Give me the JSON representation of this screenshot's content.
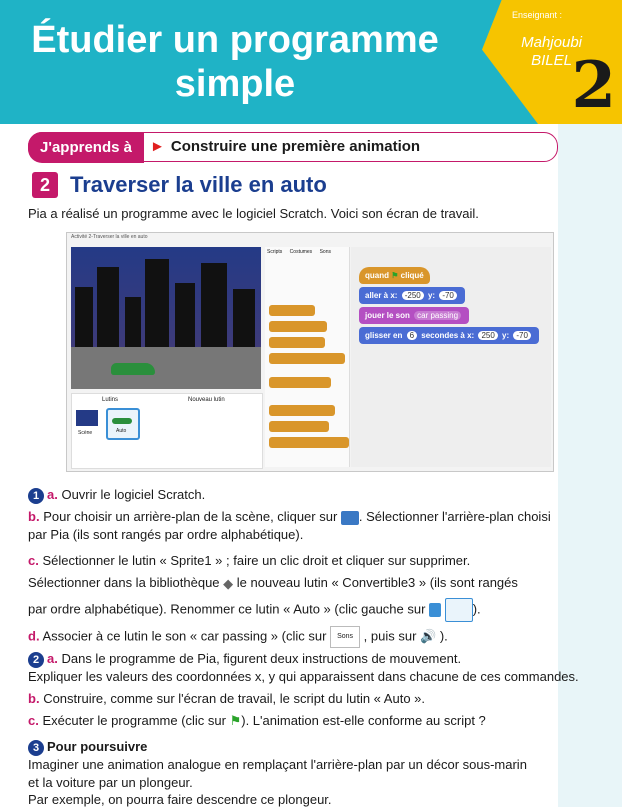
{
  "header": {
    "title_line1": "Étudier un programme",
    "title_line2": "simple",
    "teacher_label": "Enseignant :",
    "teacher_name1": "Mahjoubi",
    "teacher_name2": "BILEL",
    "grade": "2"
  },
  "learn": {
    "tag": "J'apprends à",
    "text": "Construire une première animation"
  },
  "section": {
    "number": "2",
    "title": "Traverser la ville en auto",
    "intro": "Pia a réalisé un programme avec le logiciel Scratch. Voici son écran de travail."
  },
  "scratch": {
    "project_title": "Activité 2-Traverser la ville en auto",
    "tabs": [
      "Scripts",
      "Costumes",
      "Sons"
    ],
    "script_blocks": {
      "when_flag": "quand",
      "when_flag_suffix": "cliqué",
      "goto": "aller à x:",
      "goto_x": "-250",
      "goto_y_label": "y:",
      "goto_y": "-70",
      "play_sound": "jouer le son",
      "sound_name": "car passing",
      "glide": "glisser en",
      "glide_secs": "6",
      "glide_secs_label": "secondes à x:",
      "glide_x": "250",
      "glide_y_label": "y:",
      "glide_y": "-70"
    },
    "sprites_label": "Lutins",
    "new_sprite_label": "Nouveau lutin",
    "stage_label": "Scène",
    "sprite_name": "Auto"
  },
  "q1": {
    "num": "1",
    "a_label": "a.",
    "a_text": "Ouvrir le logiciel Scratch.",
    "b_label": "b.",
    "b_text1": "Pour choisir un arrière-plan de la scène, cliquer sur",
    "b_text2": ". Sélectionner l'arrière-plan choisi",
    "b_text3": "par Pia (ils sont rangés par ordre alphabétique).",
    "c_label": "c.",
    "c_text1": "Sélectionner le lutin « Sprite1 » ; faire un clic droit et cliquer sur supprimer.",
    "c_text2a": "Sélectionner dans la bibliothèque",
    "c_text2b": "le nouveau lutin « Convertible3 » (ils sont rangés",
    "c_text3a": "par ordre alphabétique). Renommer ce lutin « Auto » (clic gauche sur",
    "c_text3b": ").",
    "d_label": "d.",
    "d_text1": "Associer à ce lutin le son « car passing » (clic sur",
    "d_sons": "Sons",
    "d_text2": ", puis sur",
    "d_text3": ")."
  },
  "q2": {
    "num": "2",
    "a_label": "a.",
    "a_text1": "Dans le programme de Pia, figurent deux instructions de mouvement.",
    "a_text2": "Expliquer les valeurs des coordonnées x, y qui apparaissent dans chacune de ces commandes.",
    "b_label": "b.",
    "b_text": "Construire, comme sur l'écran de travail, le script du lutin « Auto ».",
    "c_label": "c.",
    "c_text1": "Exécuter le programme (clic sur",
    "c_text2": "). L'animation est-elle conforme au script ?"
  },
  "q3": {
    "num": "3",
    "title": "Pour poursuivre",
    "l1": "Imaginer une animation analogue en remplaçant l'arrière-plan par un décor sous-marin",
    "l2": "et la voiture par un plongeur.",
    "l3": "Par exemple, on pourra faire descendre ce plongeur."
  }
}
